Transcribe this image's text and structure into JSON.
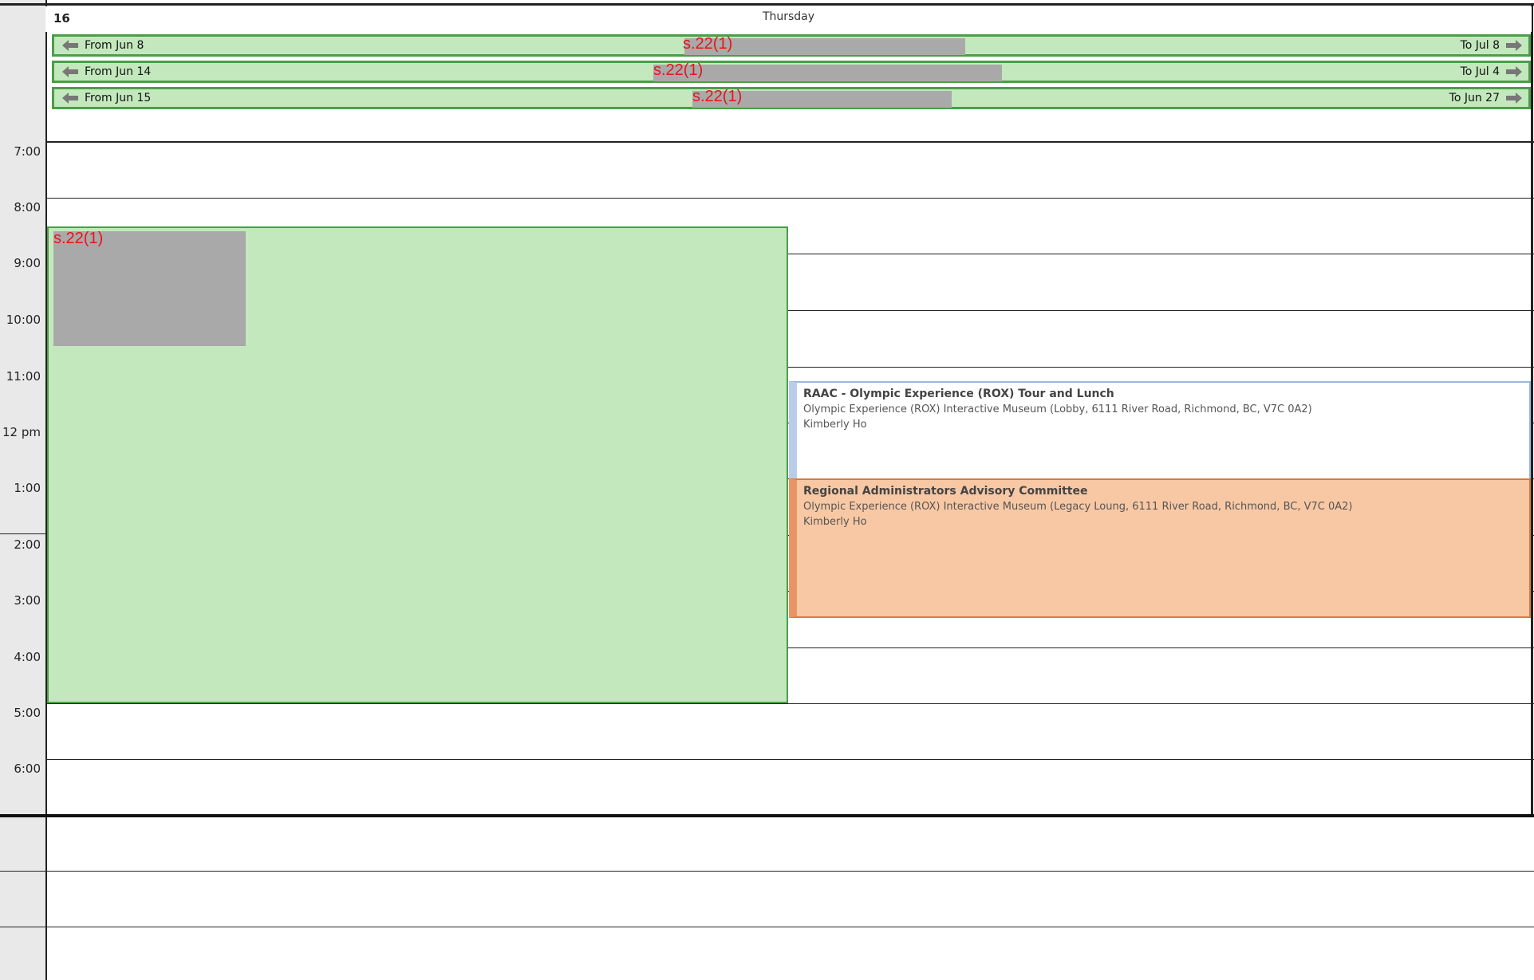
{
  "header": {
    "day_number": "16",
    "day_name": "Thursday"
  },
  "banners": [
    {
      "from": "From Jun 8",
      "redaction_label": "s.22(1)",
      "to": "To Jul 8"
    },
    {
      "from": "From Jun 14",
      "redaction_label": "s.22(1)",
      "to": "To Jul 4"
    },
    {
      "from": "From Jun 15",
      "redaction_label": "s.22(1)",
      "to": "To Jun 27"
    }
  ],
  "time_labels": [
    "7:00",
    "8:00",
    "9:00",
    "10:00",
    "11:00",
    "12 pm",
    "1:00",
    "2:00",
    "3:00",
    "4:00",
    "5:00",
    "6:00"
  ],
  "events": {
    "green_block": {
      "redaction_label": "s.22(1)"
    },
    "raac": {
      "title": "RAAC - Olympic Experience (ROX) Tour and Lunch",
      "location": "Olympic Experience (ROX) Interactive Museum (Lobby, 6111 River Road, Richmond, BC, V7C 0A2)",
      "organizer": "Kimberly Ho"
    },
    "regional": {
      "title": "Regional Administrators Advisory Committee",
      "location": "Olympic Experience (ROX) Interactive Museum (Legacy Loung, 6111 River Road, Richmond, BC, V7C 0A2)",
      "organizer": "Kimberly Ho"
    }
  },
  "colors": {
    "banner_bg": "#c3e8bd",
    "banner_border": "#4a9e48",
    "redaction_text": "#e8141b",
    "redaction_fill": "#a9a9a9",
    "orange_event": "#f8c8a4"
  }
}
